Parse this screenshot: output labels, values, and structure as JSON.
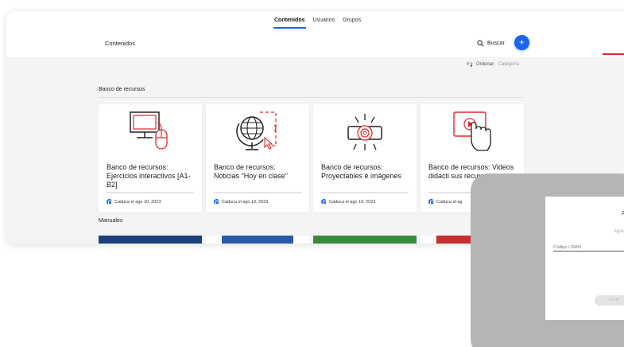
{
  "nav": {
    "tabs": [
      {
        "label": "Contenidos",
        "active": true
      },
      {
        "label": "Usuarios",
        "active": false
      },
      {
        "label": "Grupos",
        "active": false
      }
    ]
  },
  "header": {
    "title": "Contenidos",
    "search_label": "Buscar",
    "add_label": "+"
  },
  "sort": {
    "label": "Ordenar:",
    "value": "Categoría"
  },
  "sections": {
    "resources_label": "Banco de recursos",
    "manuals_label": "Manuales"
  },
  "cards": [
    {
      "title": "Banco de recursos: Ejercicios interactivos [A1-B2]",
      "expiry": "Caduca el ago 10, 2023",
      "icon": "computer-mouse-icon"
    },
    {
      "title": "Banco de recursos: Noticias \"Hoy en clase\"",
      "expiry": "Caduca el ago 10, 2023",
      "icon": "globe-cursor-icon"
    },
    {
      "title": "Banco de recursos: Proyectables e imágenes",
      "expiry": "Caduca el ago 10, 2023",
      "icon": "projector-icon"
    },
    {
      "title": "Banco de recursos: Videos didacti sus recurso",
      "expiry": "Caduca el ag",
      "icon": "video-touch-icon"
    }
  ],
  "manual_covers": [
    "#1d3f7a",
    "#ffffff",
    "#3a8a3e",
    "#ffffff"
  ],
  "dialog": {
    "title": "A",
    "subtitle": "Agre",
    "input_placeholder": "Código / ISBN",
    "button_label": "Conti"
  },
  "colors": {
    "accent": "#1a66e8",
    "brand_red": "#e0282e"
  }
}
